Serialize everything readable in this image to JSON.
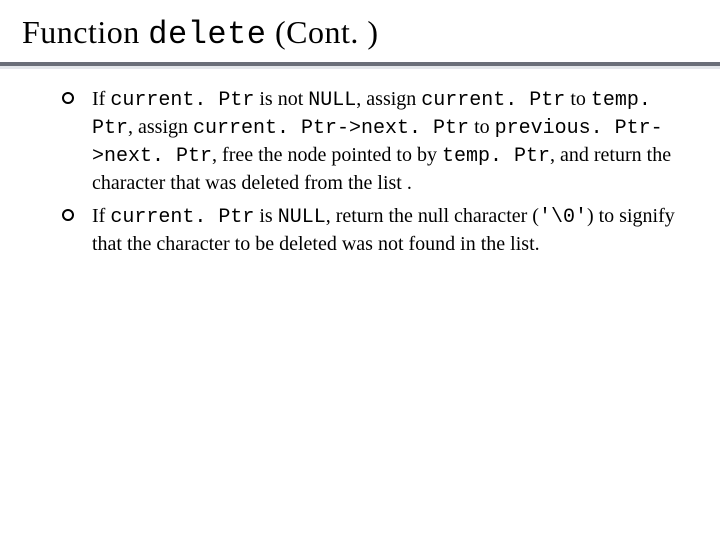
{
  "title": {
    "prefix": "Function ",
    "code": "delete",
    "suffix": " (Cont. )"
  },
  "bullets": [
    {
      "t1": "If ",
      "c1": "current. Ptr",
      "t2": " is not ",
      "c2": "NULL",
      "t3": ", assign ",
      "c3": "current. Ptr",
      "t4": " to ",
      "c4": "temp. Ptr",
      "t5": ", assign ",
      "c5": "current. Ptr->next. Ptr",
      "t6": " to ",
      "c6": "previous. Ptr->next. Ptr",
      "t7": ", free the node pointed to by ",
      "c7": "temp. Ptr",
      "t8": ", and return the character that was deleted from the list ."
    },
    {
      "t1": "If ",
      "c1": "current. Ptr",
      "t2": " is ",
      "c2": "NULL",
      "t3": ", return the null character (",
      "c3": "'\\0'",
      "t4": ") to signify that the character to be deleted was not found in the list."
    }
  ]
}
